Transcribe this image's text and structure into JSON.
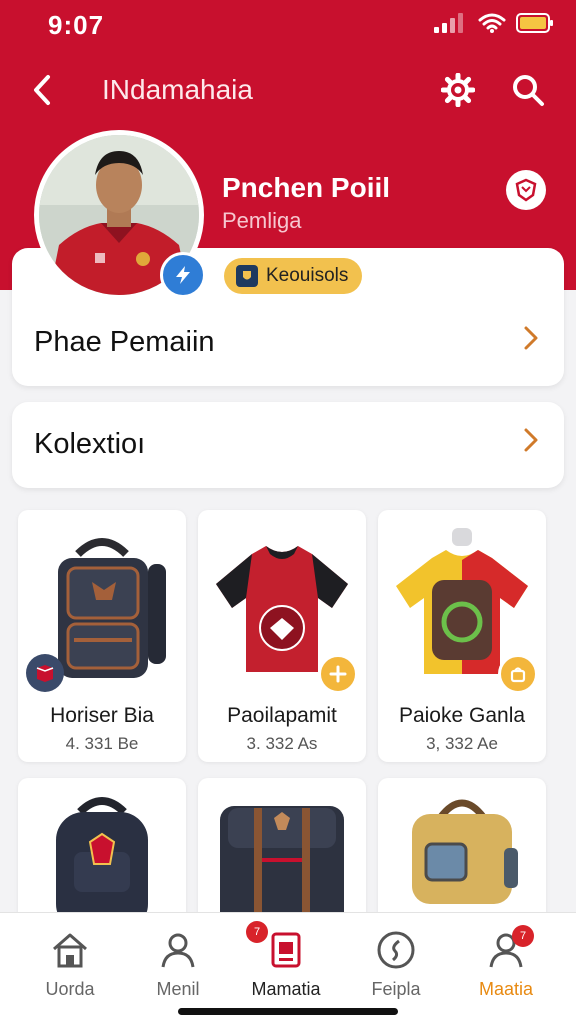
{
  "status_bar": {
    "time": "9:07"
  },
  "topbar": {
    "title": "INdamahaia"
  },
  "profile": {
    "name": "Pnchen Poiil",
    "subtitle": "Pemliga",
    "club_badge": "Keouisols"
  },
  "cards": {
    "player": "Phae Pemaiin",
    "collection": "Kolextioı"
  },
  "items": [
    {
      "name": "Horiser Bia",
      "price": "4. 331 Be"
    },
    {
      "name": "Paoilapamit",
      "price": "3. 332 As"
    },
    {
      "name": "Paioke Ganla",
      "price": "3, 332 Ae"
    }
  ],
  "bottom_nav": [
    {
      "label": "Uorda",
      "icon": "home-icon"
    },
    {
      "label": "Menil",
      "icon": "user-icon"
    },
    {
      "label": "Mamatia",
      "icon": "card-icon",
      "badge": "7"
    },
    {
      "label": "Feipla",
      "icon": "compass-icon"
    },
    {
      "label": "Maatia",
      "icon": "profile-icon",
      "badge": "7"
    }
  ],
  "colors": {
    "header": "#c8102e",
    "accent": "#f3b63b",
    "active_tab": "#c8102e",
    "highlight_label": "#e88a12"
  }
}
